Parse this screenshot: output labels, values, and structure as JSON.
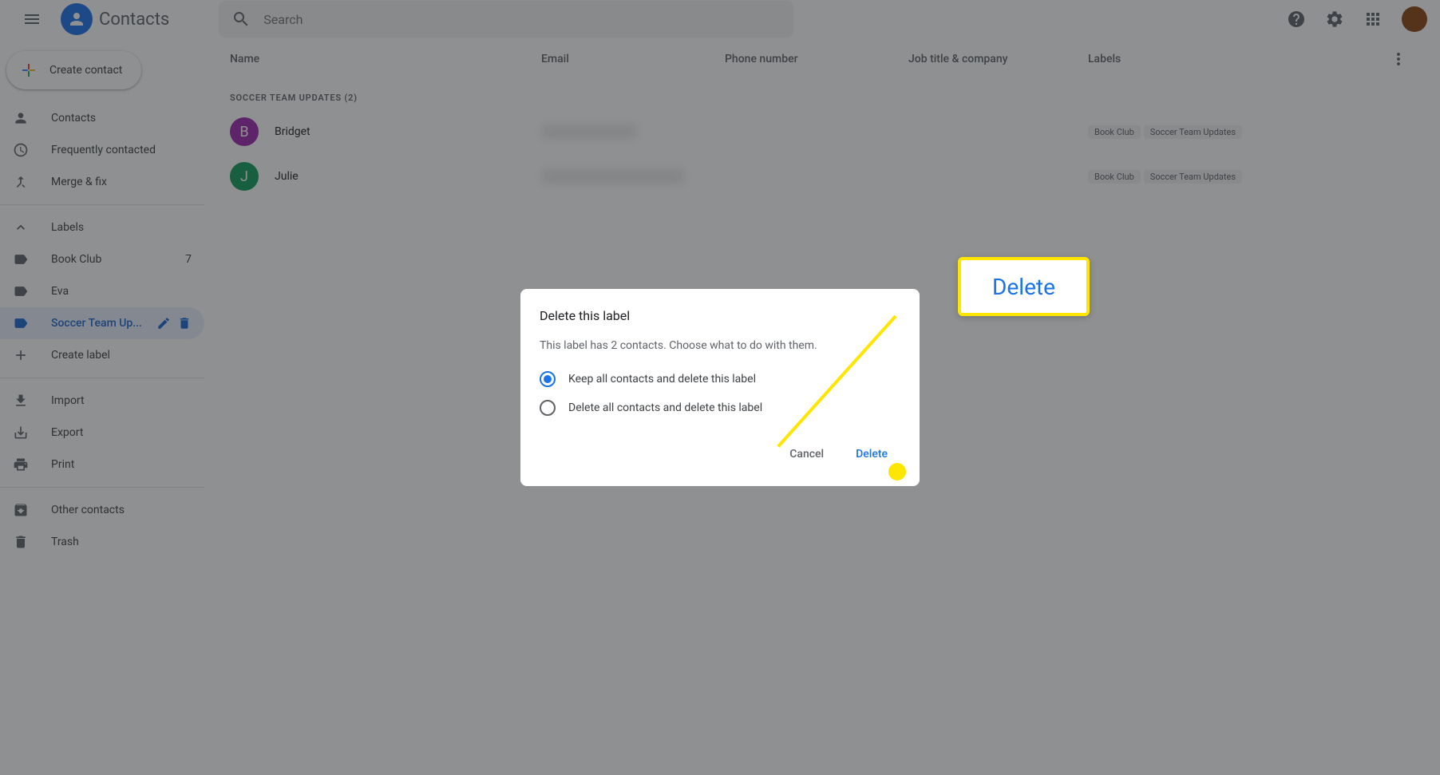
{
  "app_title": "Contacts",
  "search_placeholder": "Search",
  "create_contact_label": "Create contact",
  "sidebar": {
    "contacts": "Contacts",
    "frequent": "Frequently contacted",
    "merge": "Merge & fix",
    "labels_header": "Labels",
    "labels": [
      {
        "name": "Book Club",
        "count": "7"
      },
      {
        "name": "Eva",
        "count": ""
      },
      {
        "name": "Soccer Team Up...",
        "count": ""
      }
    ],
    "create_label": "Create label",
    "import": "Import",
    "export": "Export",
    "print": "Print",
    "other": "Other contacts",
    "trash": "Trash"
  },
  "table": {
    "columns": {
      "name": "Name",
      "email": "Email",
      "phone": "Phone number",
      "job": "Job title & company",
      "labels": "Labels"
    },
    "group_header": "SOCCER TEAM UPDATES (2)",
    "rows": [
      {
        "initial": "B",
        "color": "#9c27b0",
        "name": "Bridget",
        "chips": [
          "Book Club",
          "Soccer Team Updates"
        ]
      },
      {
        "initial": "J",
        "color": "#0f9d58",
        "name": "Julie",
        "chips": [
          "Book Club",
          "Soccer Team Updates"
        ]
      }
    ]
  },
  "dialog": {
    "title": "Delete this label",
    "message": "This label has 2 contacts. Choose what to do with them.",
    "option_keep": "Keep all contacts and delete this label",
    "option_delete": "Delete all contacts and delete this label",
    "cancel": "Cancel",
    "confirm": "Delete"
  },
  "callout_text": "Delete"
}
